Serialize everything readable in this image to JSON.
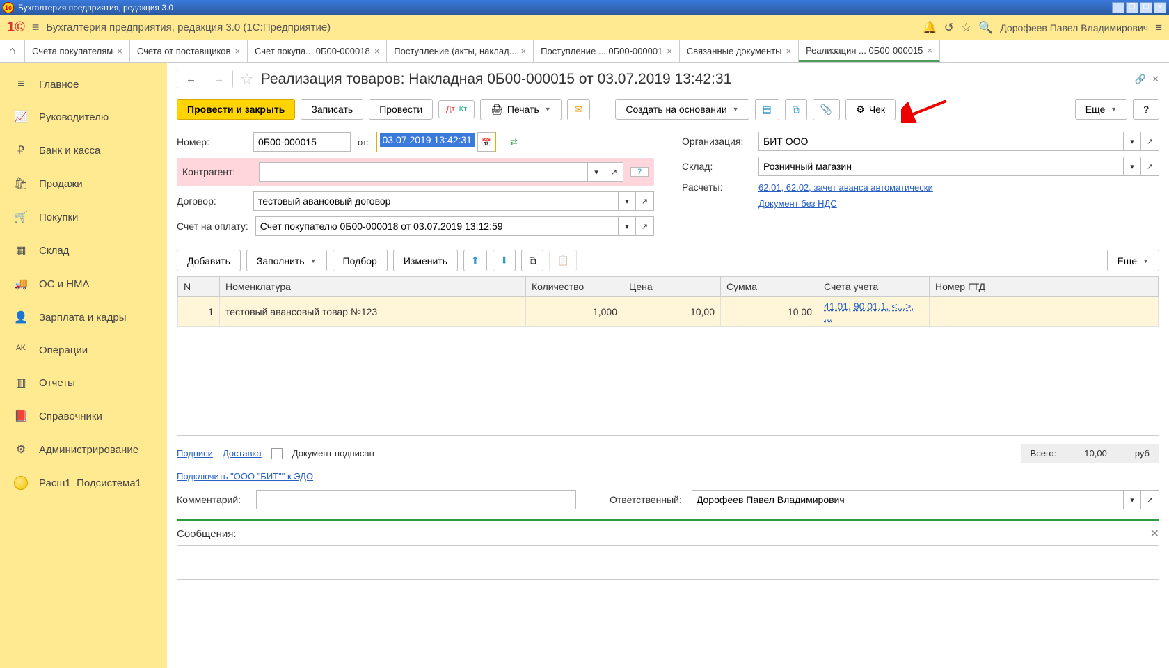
{
  "title_bar": {
    "title": "Бухгалтерия предприятия, редакция 3.0"
  },
  "app_bar": {
    "title": "Бухгалтерия предприятия, редакция 3.0  (1С:Предприятие)",
    "user": "Дорофеев Павел Владимирович"
  },
  "tabs": [
    {
      "label": "Счета покупателям"
    },
    {
      "label": "Счета от поставщиков"
    },
    {
      "label": "Счет покупа...   0Б00-000018"
    },
    {
      "label": "Поступление (акты, наклад..."
    },
    {
      "label": "Поступление ...  0Б00-000001"
    },
    {
      "label": "Связанные документы"
    },
    {
      "label": "Реализация ...   0Б00-000015",
      "active": true
    }
  ],
  "sidebar": {
    "items": [
      {
        "icon": "≡",
        "label": "Главное"
      },
      {
        "icon": "📈",
        "label": "Руководителю"
      },
      {
        "icon": "₽",
        "label": "Банк и касса"
      },
      {
        "icon": "🛍",
        "label": "Продажи"
      },
      {
        "icon": "🛒",
        "label": "Покупки"
      },
      {
        "icon": "▦",
        "label": "Склад"
      },
      {
        "icon": "🚚",
        "label": "ОС и НМА"
      },
      {
        "icon": "👤",
        "label": "Зарплата и кадры"
      },
      {
        "icon": "ᴬᴷ",
        "label": "Операции"
      },
      {
        "icon": "▥",
        "label": "Отчеты"
      },
      {
        "icon": "📕",
        "label": "Справочники"
      },
      {
        "icon": "⚙",
        "label": "Администрирование"
      }
    ],
    "custom": {
      "label": "Расш1_Подсистема1"
    }
  },
  "document": {
    "title": "Реализация товаров: Накладная 0Б00-000015 от 03.07.2019 13:42:31",
    "toolbar": {
      "post_close": "Провести и закрыть",
      "save": "Записать",
      "post": "Провести",
      "print": "Печать",
      "create_based": "Создать на основании",
      "receipt": "Чек",
      "more": "Еще",
      "help": "?"
    },
    "fields": {
      "number_label": "Номер:",
      "number": "0Б00-000015",
      "date_label": "от:",
      "date": "03.07.2019 13:42:31",
      "org_label": "Организация:",
      "org": "БИТ ООО",
      "contragent_label": "Контрагент:",
      "contragent": "",
      "warehouse_label": "Склад:",
      "warehouse": "Розничный магазин",
      "contract_label": "Договор:",
      "contract": "тестовый авансовый договор",
      "calc_label": "Расчеты:",
      "calc_link": "62.01, 62.02, зачет аванса автоматически",
      "invoice_label": "Счет на оплату:",
      "invoice": "Счет покупателю 0Б00-000018 от 03.07.2019 13:12:59",
      "vat_link": "Документ без НДС"
    },
    "grid": {
      "toolbar": {
        "add": "Добавить",
        "fill": "Заполнить",
        "select": "Подбор",
        "change": "Изменить",
        "more": "Еще"
      },
      "columns": [
        "N",
        "Номенклатура",
        "Количество",
        "Цена",
        "Сумма",
        "Счета учета",
        "Номер ГТД"
      ],
      "rows": [
        {
          "n": "1",
          "name": "тестовый авансовый товар №123",
          "qty": "1,000",
          "price": "10,00",
          "sum": "10,00",
          "accounts": "41.01, 90.01.1, <...>, ..."
        }
      ]
    },
    "footer": {
      "signatures": "Подписи",
      "delivery": "Доставка",
      "signed": "Документ подписан",
      "total_label": "Всего:",
      "total": "10,00",
      "currency": "руб",
      "edo_link": "Подключить \"ООО \"БИТ\"\" к ЭДО",
      "comment_label": "Комментарий:",
      "responsible_label": "Ответственный:",
      "responsible": "Дорофеев Павел Владимирович"
    },
    "messages_label": "Сообщения:"
  }
}
